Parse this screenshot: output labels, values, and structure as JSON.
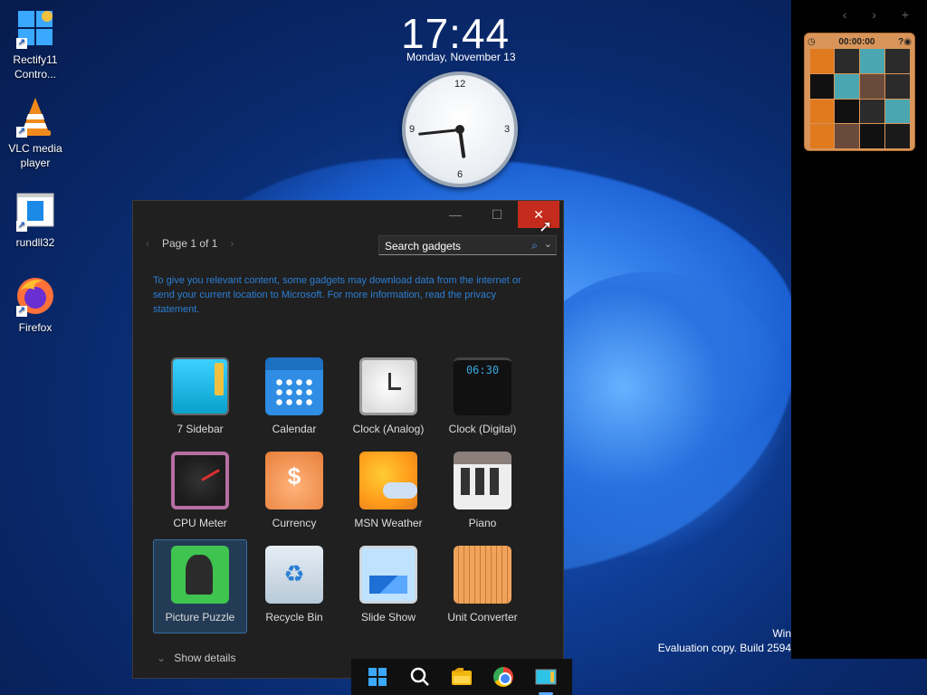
{
  "desktop": {
    "icons": [
      {
        "label": "Rectify11 Contro...",
        "icon": "control-panel-icon"
      },
      {
        "label": "VLC media player",
        "icon": "vlc-icon"
      },
      {
        "label": "rundll32",
        "icon": "rundll32-icon"
      },
      {
        "label": "Firefox",
        "icon": "firefox-icon"
      }
    ],
    "shortcut_glyph": "↗"
  },
  "clock": {
    "time": "17:44",
    "date": "Monday, November 13",
    "dial": {
      "n12": "12",
      "n3": "3",
      "n6": "6",
      "n9": "9"
    },
    "hour": 17,
    "minute": 44
  },
  "sidebar": {
    "controls": "‹ › +",
    "puzzle": {
      "timer": "00:00:00"
    }
  },
  "dialog": {
    "page_label": "Page 1 of 1",
    "prev": "‹",
    "next": "›",
    "minimize": "—",
    "maximize": "☐",
    "close": "✕",
    "search_placeholder": "Search gadgets",
    "info": "To give you relevant content, some gadgets may download data from the internet or send your current location to Microsoft. For more information, read the privacy statement.",
    "gadgets": [
      {
        "label": "7 Sidebar",
        "icon": "sidebar-gadget-icon"
      },
      {
        "label": "Calendar",
        "icon": "calendar-gadget-icon"
      },
      {
        "label": "Clock (Analog)",
        "icon": "analog-clock-gadget-icon"
      },
      {
        "label": "Clock (Digital)",
        "icon": "digital-clock-gadget-icon",
        "display": "06:30"
      },
      {
        "label": "CPU Meter",
        "icon": "cpu-meter-gadget-icon"
      },
      {
        "label": "Currency",
        "icon": "currency-gadget-icon",
        "display": "$"
      },
      {
        "label": "MSN Weather",
        "icon": "weather-gadget-icon"
      },
      {
        "label": "Piano",
        "icon": "piano-gadget-icon"
      },
      {
        "label": "Picture Puzzle",
        "icon": "picture-puzzle-gadget-icon",
        "selected": true
      },
      {
        "label": "Recycle Bin",
        "icon": "recycle-bin-gadget-icon"
      },
      {
        "label": "Slide Show",
        "icon": "slide-show-gadget-icon"
      },
      {
        "label": "Unit Converter",
        "icon": "unit-converter-gadget-icon"
      }
    ],
    "show_details": "Show details"
  },
  "taskbar": {
    "items": [
      "start-icon",
      "search-icon",
      "file-explorer-icon",
      "chrome-icon",
      "gadgets-icon"
    ],
    "active": "gadgets-icon"
  },
  "watermark": {
    "line1": "Win",
    "line2": "Evaluation copy. Build 2594"
  },
  "colors": {
    "accent": "#3aa8ff",
    "close_button": "#c42b1c",
    "info_link": "#2c7fd6",
    "selection": "#243b55"
  }
}
